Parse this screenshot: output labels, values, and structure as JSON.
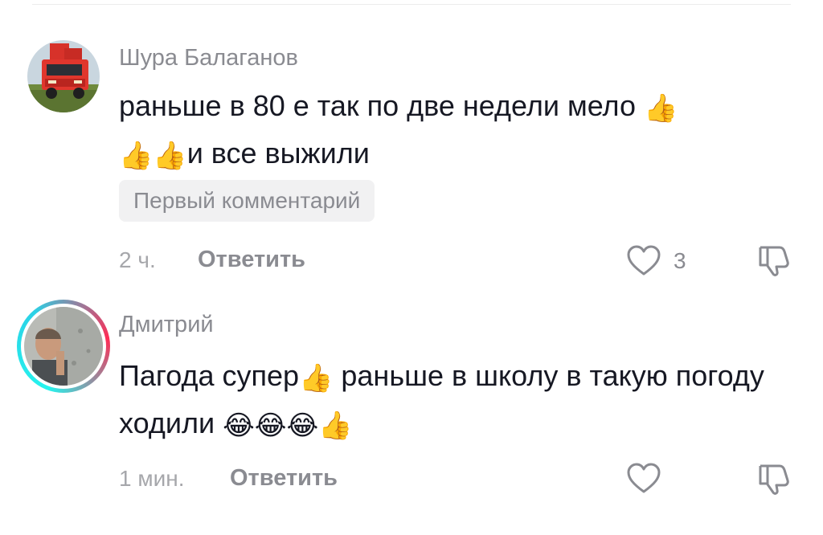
{
  "comments": [
    {
      "username": "Шура Балаганов",
      "text_part1": "раньше в 80 е так по две недели мело ",
      "emoji1": "👍",
      "text_line2_emoji1": "👍",
      "text_line2_emoji2": "👍",
      "text_part2": "и все выжили",
      "badge": "Первый комментарий",
      "time": "2 ч.",
      "reply_label": "Ответить",
      "like_count": "3",
      "avatar": "truck-photo"
    },
    {
      "username": "Дмитрий",
      "text_part1": "Пагода супер",
      "emoji1": "👍",
      "text_part2": " раньше в школу в такую погоду ходили ",
      "emoji_laugh1": "😂",
      "emoji_laugh2": "😂",
      "emoji_laugh3": "😂",
      "emoji_end": "👍",
      "time": "1 мин.",
      "reply_label": "Ответить",
      "like_count": "",
      "avatar": "man-photo",
      "has_story_ring": true
    }
  ],
  "icons": {
    "like": "heart-outline-icon",
    "dislike": "thumbs-down-outline-icon"
  },
  "colors": {
    "text": "#161823",
    "secondary": "#8a8b91",
    "badge_bg": "#f1f1f2",
    "ring_cyan": "#25f4ee",
    "ring_red": "#fe2c55"
  }
}
